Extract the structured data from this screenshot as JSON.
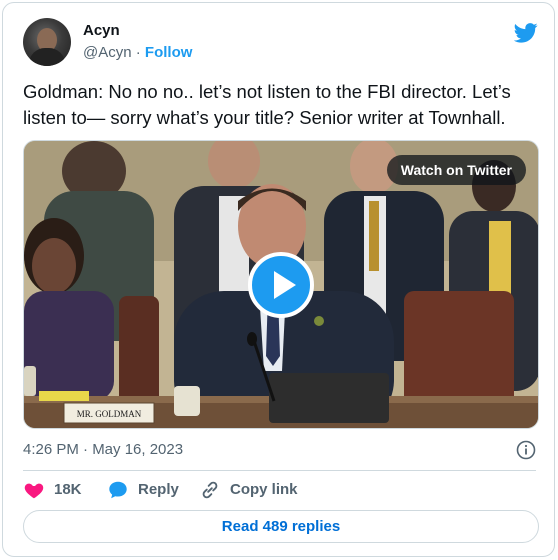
{
  "author": {
    "display_name": "Acyn",
    "handle": "@Acyn",
    "separator": " · ",
    "follow_label": "Follow"
  },
  "tweet": {
    "text": "Goldman: No no no.. let’s not listen to the FBI director. Let’s listen to— sorry what’s your title? Senior writer at Townhall.",
    "timestamp": "4:26 PM · May 16, 2023"
  },
  "media": {
    "watch_label": "Watch on Twitter",
    "nameplate_text": "MR. GOLDMAN",
    "play_icon": "play-icon"
  },
  "actions": {
    "likes_count": "18K",
    "reply_label": "Reply",
    "copy_link_label": "Copy link"
  },
  "footer": {
    "read_replies_label": "Read 489 replies"
  },
  "colors": {
    "brand_blue": "#1d9bf0",
    "like_red": "#f91880",
    "link_blue": "#006fd6",
    "muted_text": "#536471",
    "border": "#cfd9de"
  }
}
